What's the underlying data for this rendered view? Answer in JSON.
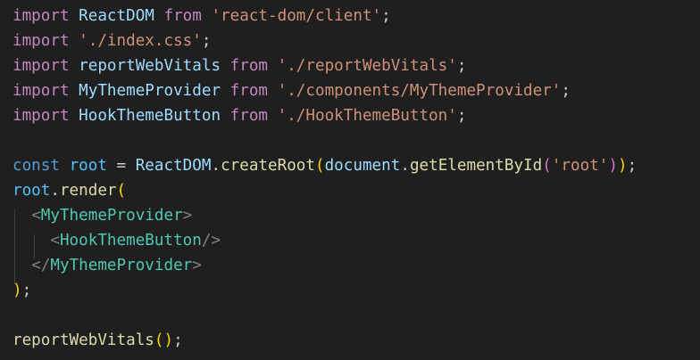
{
  "editor": {
    "language": "javascript",
    "lines": [
      [
        {
          "t": "import",
          "c": "import"
        },
        {
          "t": " ",
          "c": "plain"
        },
        {
          "t": "ReactDOM",
          "c": "ident"
        },
        {
          "t": " ",
          "c": "plain"
        },
        {
          "t": "from",
          "c": "import"
        },
        {
          "t": " ",
          "c": "plain"
        },
        {
          "t": "'react-dom/client'",
          "c": "str"
        },
        {
          "t": ";",
          "c": "punc"
        }
      ],
      [
        {
          "t": "import",
          "c": "import"
        },
        {
          "t": " ",
          "c": "plain"
        },
        {
          "t": "'./index.css'",
          "c": "str"
        },
        {
          "t": ";",
          "c": "punc"
        }
      ],
      [
        {
          "t": "import",
          "c": "import"
        },
        {
          "t": " ",
          "c": "plain"
        },
        {
          "t": "reportWebVitals",
          "c": "ident"
        },
        {
          "t": " ",
          "c": "plain"
        },
        {
          "t": "from",
          "c": "import"
        },
        {
          "t": " ",
          "c": "plain"
        },
        {
          "t": "'./reportWebVitals'",
          "c": "str"
        },
        {
          "t": ";",
          "c": "punc"
        }
      ],
      [
        {
          "t": "import",
          "c": "import"
        },
        {
          "t": " ",
          "c": "plain"
        },
        {
          "t": "MyThemeProvider",
          "c": "ident"
        },
        {
          "t": " ",
          "c": "plain"
        },
        {
          "t": "from",
          "c": "import"
        },
        {
          "t": " ",
          "c": "plain"
        },
        {
          "t": "'./components/MyThemeProvider'",
          "c": "str"
        },
        {
          "t": ";",
          "c": "punc"
        }
      ],
      [
        {
          "t": "import",
          "c": "import"
        },
        {
          "t": " ",
          "c": "plain"
        },
        {
          "t": "HookThemeButton",
          "c": "ident"
        },
        {
          "t": " ",
          "c": "plain"
        },
        {
          "t": "from",
          "c": "import"
        },
        {
          "t": " ",
          "c": "plain"
        },
        {
          "t": "'./HookThemeButton'",
          "c": "str"
        },
        {
          "t": ";",
          "c": "punc"
        }
      ],
      [],
      [
        {
          "t": "const",
          "c": "const"
        },
        {
          "t": " ",
          "c": "plain"
        },
        {
          "t": "root",
          "c": "var"
        },
        {
          "t": " = ",
          "c": "plain"
        },
        {
          "t": "ReactDOM",
          "c": "ident"
        },
        {
          "t": ".",
          "c": "punc"
        },
        {
          "t": "createRoot",
          "c": "func"
        },
        {
          "t": "(",
          "c": "brace1"
        },
        {
          "t": "document",
          "c": "ident"
        },
        {
          "t": ".",
          "c": "punc"
        },
        {
          "t": "getElementById",
          "c": "func"
        },
        {
          "t": "(",
          "c": "brace2"
        },
        {
          "t": "'root'",
          "c": "str"
        },
        {
          "t": ")",
          "c": "brace2"
        },
        {
          "t": ")",
          "c": "brace1"
        },
        {
          "t": ";",
          "c": "punc"
        }
      ],
      [
        {
          "t": "root",
          "c": "var"
        },
        {
          "t": ".",
          "c": "punc"
        },
        {
          "t": "render",
          "c": "func"
        },
        {
          "t": "(",
          "c": "brace1"
        }
      ],
      [
        {
          "t": "  ",
          "c": "plain"
        },
        {
          "t": "<",
          "c": "tagbr"
        },
        {
          "t": "MyThemeProvider",
          "c": "jsx"
        },
        {
          "t": ">",
          "c": "tagbr"
        }
      ],
      [
        {
          "t": "    ",
          "c": "plain"
        },
        {
          "t": "<",
          "c": "tagbr"
        },
        {
          "t": "HookThemeButton",
          "c": "jsx"
        },
        {
          "t": "/>",
          "c": "tagbr"
        }
      ],
      [
        {
          "t": "  ",
          "c": "plain"
        },
        {
          "t": "</",
          "c": "tagbr"
        },
        {
          "t": "MyThemeProvider",
          "c": "jsx"
        },
        {
          "t": ">",
          "c": "tagbr"
        }
      ],
      [
        {
          "t": ")",
          "c": "brace1"
        },
        {
          "t": ";",
          "c": "punc"
        }
      ],
      [],
      [
        {
          "t": "reportWebVitals",
          "c": "func"
        },
        {
          "t": "(",
          "c": "brace1"
        },
        {
          "t": ")",
          "c": "brace1"
        },
        {
          "t": ";",
          "c": "punc"
        }
      ]
    ]
  }
}
